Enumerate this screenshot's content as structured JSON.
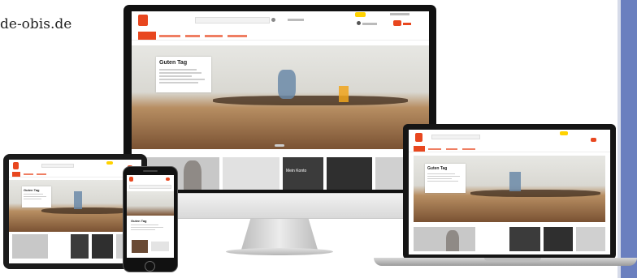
{
  "brand": {
    "domain_text": "de-obis.de"
  },
  "colors": {
    "accent": "#e8471f",
    "badge": "#ffd200",
    "side_bar": "#6a7fbf",
    "wood": "#7a5233"
  },
  "site": {
    "hero_title": "Guten Tag",
    "tile_label_monitor": "Mein Konto"
  },
  "devices": [
    "desktop-monitor",
    "laptop",
    "tablet",
    "smartphone"
  ]
}
